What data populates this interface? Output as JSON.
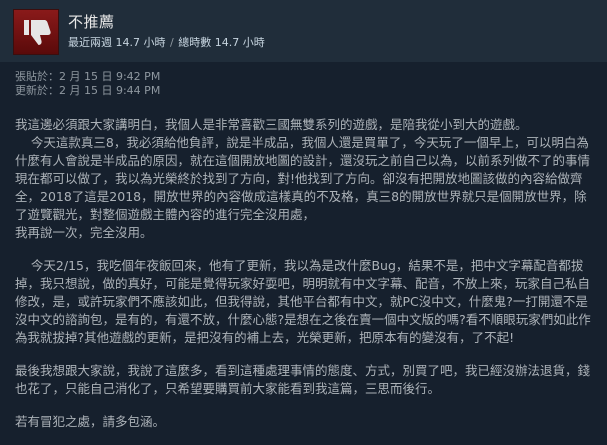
{
  "header": {
    "verdict": "不推薦",
    "hours_recent_label": "最近兩週",
    "hours_recent_value": "14.7 小時",
    "separator": "/",
    "hours_total_label": "總時數",
    "hours_total_value": "14.7 小時"
  },
  "meta": {
    "posted": "張貼於：2 月 15 日 9:42 PM",
    "updated": "更新於：2 月 15 日 9:44 PM"
  },
  "review": {
    "p1": "我這邊必須跟大家講明白，我個人是非常喜歡三國無雙系列的遊戲，是陪我從小到大的遊戲。\n    今天這款真三8，我必須給他負評，說是半成品，我個人還是買單了，今天玩了一個早上，可以明白為什麼有人會說是半成品的原因，就在這個開放地圖的設計，還沒玩之前自己以為，以前系列做不了的事情現在都可以做了，我以為光榮終於找到了方向，對!他找到了方向。卻沒有把開放地圖該做的內容給做齊全，2018了這是2018，開放世界的內容做成這樣真的不及格，真三8的開放世界就只是個開放世界，除了遊覽觀光，對整個遊戲主體內容的進行完全沒用處，\n我再說一次，完全沒用。",
    "p2": "    今天2/15，我吃個年夜飯回來，他有了更新，我以為是改什麼Bug，結果不是，把中文字幕配音都拔掉，我只想說，做的真好，可能是覺得玩家好耍吧，明明就有中文字幕、配音，不放上來，玩家自己私自修改，是，或許玩家們不應該如此，但我得說，其他平台都有中文，就PC沒中文，什麼鬼?一打開還不是沒中文的諮詢包，是有的，有還不放，什麼心態?是想在之後在賣一個中文版的嗎?看不順眼玩家們如此作為我就拔掉?其他遊戲的更新，是把沒有的補上去，光榮更新，把原本有的變沒有，了不起!",
    "p3": "最後我想跟大家說，我說了這麼多，看到這種處理事情的態度、方式，別買了吧，我已經沒辦法退貨，錢也花了，只能自己消化了，只希望要購買前大家能看到我這篇，三思而後行。",
    "p4": "若有冒犯之處，請多包涵。"
  },
  "icons": {
    "verdict_icon": "thumbs-down-icon"
  },
  "colors": {
    "background": "#16202d",
    "header": "#202d3a",
    "thumb_red": "#8a1a1a"
  }
}
